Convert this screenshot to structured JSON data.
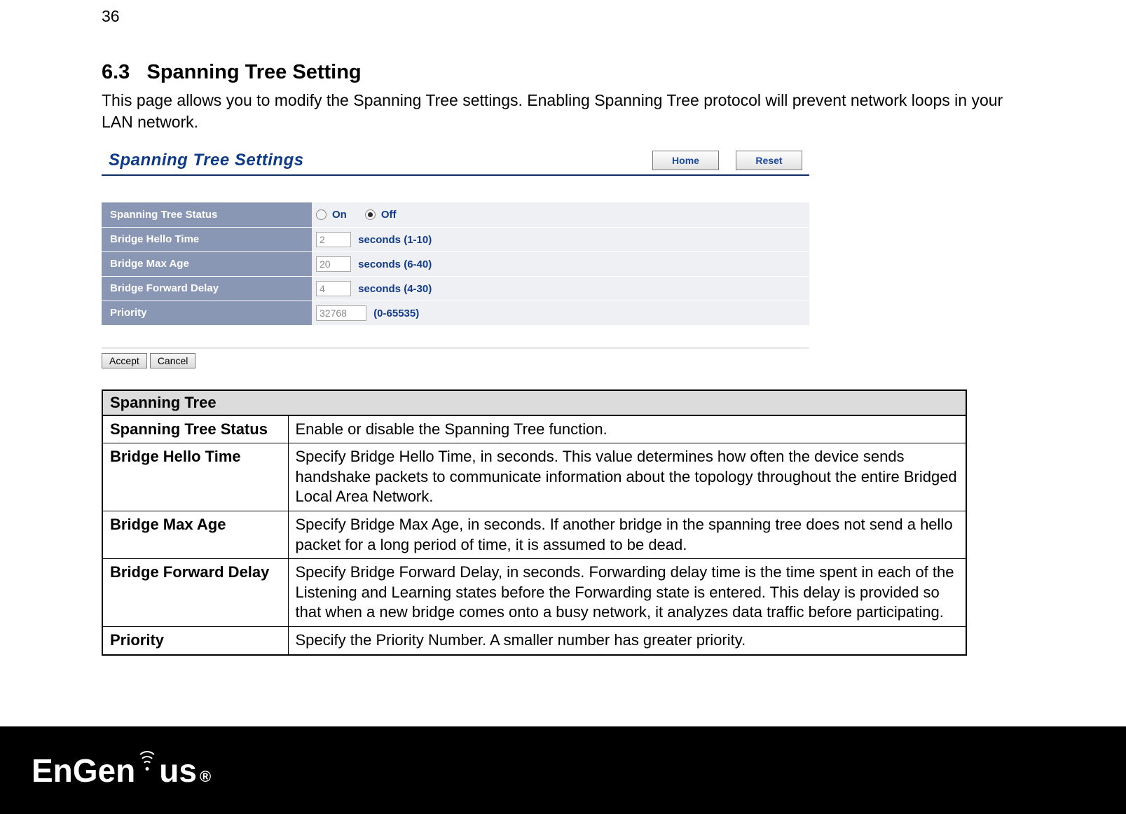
{
  "page_number": "36",
  "section": {
    "number": "6.3",
    "title": "Spanning Tree Setting",
    "intro": "This page allows you to modify the Spanning Tree settings. Enabling Spanning Tree protocol will prevent network loops in your LAN network."
  },
  "screenshot": {
    "title": "Spanning Tree Settings",
    "home_btn": "Home",
    "reset_btn": "Reset",
    "rows": {
      "status": {
        "label": "Spanning Tree Status",
        "on": "On",
        "off": "Off"
      },
      "hello": {
        "label": "Bridge Hello Time",
        "value": "2",
        "hint": "seconds (1-10)"
      },
      "maxage": {
        "label": "Bridge Max Age",
        "value": "20",
        "hint": "seconds (6-40)"
      },
      "forward": {
        "label": "Bridge Forward Delay",
        "value": "4",
        "hint": "seconds (4-30)"
      },
      "priority": {
        "label": "Priority",
        "value": "32768",
        "hint": "(0-65535)"
      }
    },
    "accept_btn": "Accept",
    "cancel_btn": "Cancel"
  },
  "desc_table": {
    "header": "Spanning Tree",
    "rows": [
      {
        "label": "Spanning Tree Status",
        "desc": "Enable or disable the Spanning Tree function."
      },
      {
        "label": "Bridge Hello Time",
        "desc": "Specify Bridge Hello Time, in seconds. This value determines how often the device sends handshake packets to communicate information about the topology throughout the entire Bridged Local Area Network."
      },
      {
        "label": "Bridge Max Age",
        "desc": "Specify Bridge Max Age, in seconds. If another bridge in the spanning tree does not send a hello packet for a long period of time, it is assumed to be dead."
      },
      {
        "label": "Bridge Forward Delay",
        "desc": "Specify Bridge Forward Delay, in seconds. Forwarding delay time is the time spent in each of the Listening and Learning states before the Forwarding state is entered. This delay is provided so that when a new bridge comes onto a busy network, it analyzes data traffic before participating."
      },
      {
        "label": "Priority",
        "desc": "Specify the Priority Number. A smaller number has greater priority."
      }
    ]
  },
  "logo": {
    "part1": "EnGen",
    "part2": "us",
    "reg": "®"
  }
}
